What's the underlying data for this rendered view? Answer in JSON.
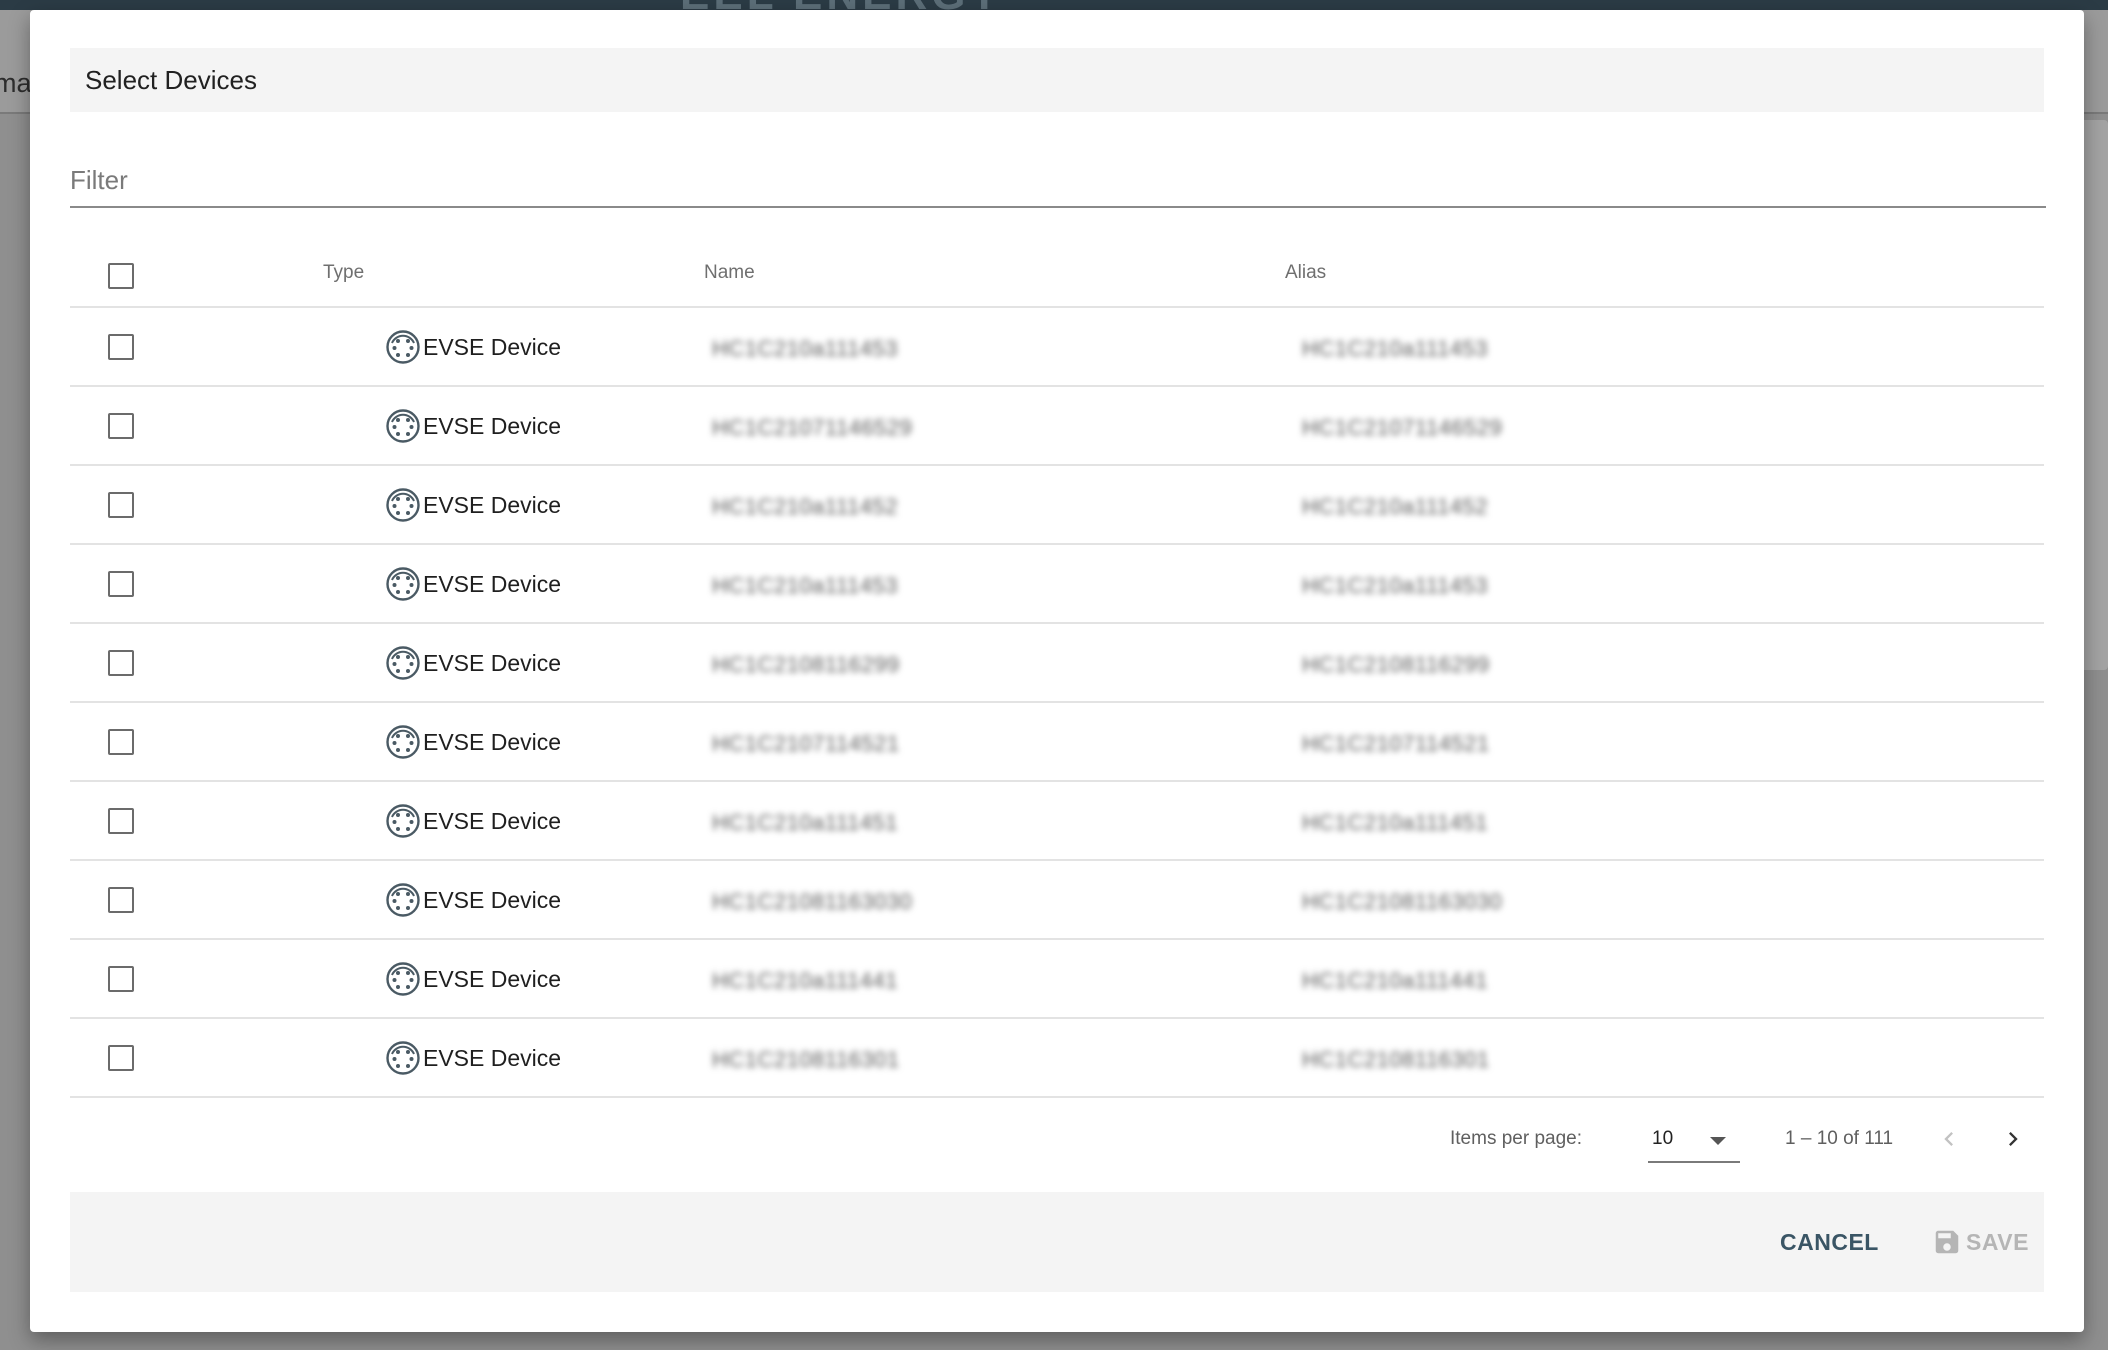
{
  "background": {
    "appbar_text": "mag",
    "logo_text": "EEL ENERGY"
  },
  "dialog": {
    "title": "Select Devices",
    "filter": {
      "placeholder": "Filter",
      "value": ""
    },
    "table": {
      "columns": [
        "Type",
        "Name",
        "Alias"
      ],
      "rows": [
        {
          "type": "EVSE Device",
          "type_icon": "evse-connector-icon",
          "name": "HC1C210a111453",
          "alias": "HC1C210a111453"
        },
        {
          "type": "EVSE Device",
          "type_icon": "evse-connector-icon",
          "name": "HC1C21071146529",
          "alias": "HC1C21071146529"
        },
        {
          "type": "EVSE Device",
          "type_icon": "evse-connector-icon",
          "name": "HC1C210a111452",
          "alias": "HC1C210a111452"
        },
        {
          "type": "EVSE Device",
          "type_icon": "evse-connector-icon",
          "name": "HC1C210a111453",
          "alias": "HC1C210a111453"
        },
        {
          "type": "EVSE Device",
          "type_icon": "evse-connector-icon",
          "name": "HC1C2108116299",
          "alias": "HC1C2108116299"
        },
        {
          "type": "EVSE Device",
          "type_icon": "evse-connector-icon",
          "name": "HC1C2107114521",
          "alias": "HC1C2107114521"
        },
        {
          "type": "EVSE Device",
          "type_icon": "evse-connector-icon",
          "name": "HC1C210a111451",
          "alias": "HC1C210a111451"
        },
        {
          "type": "EVSE Device",
          "type_icon": "evse-connector-icon",
          "name": "HC1C21081163030",
          "alias": "HC1C21081163030"
        },
        {
          "type": "EVSE Device",
          "type_icon": "evse-connector-icon",
          "name": "HC1C210a111441",
          "alias": "HC1C210a111441"
        },
        {
          "type": "EVSE Device",
          "type_icon": "evse-connector-icon",
          "name": "HC1C2108116301",
          "alias": "HC1C2108116301"
        }
      ]
    },
    "paginator": {
      "items_per_page_label": "Items per page:",
      "items_per_page_value": "10",
      "range_label": "1 – 10 of 111",
      "prev_icon": "chevron-left-icon",
      "next_icon": "chevron-right-icon"
    },
    "footer": {
      "cancel_label": "CANCEL",
      "save_label": "SAVE",
      "save_icon": "floppy-disk-icon"
    }
  },
  "colors": {
    "accent": "#3a5565",
    "disabled": "#b5b5b5",
    "header_bg": "#f4f4f4"
  }
}
